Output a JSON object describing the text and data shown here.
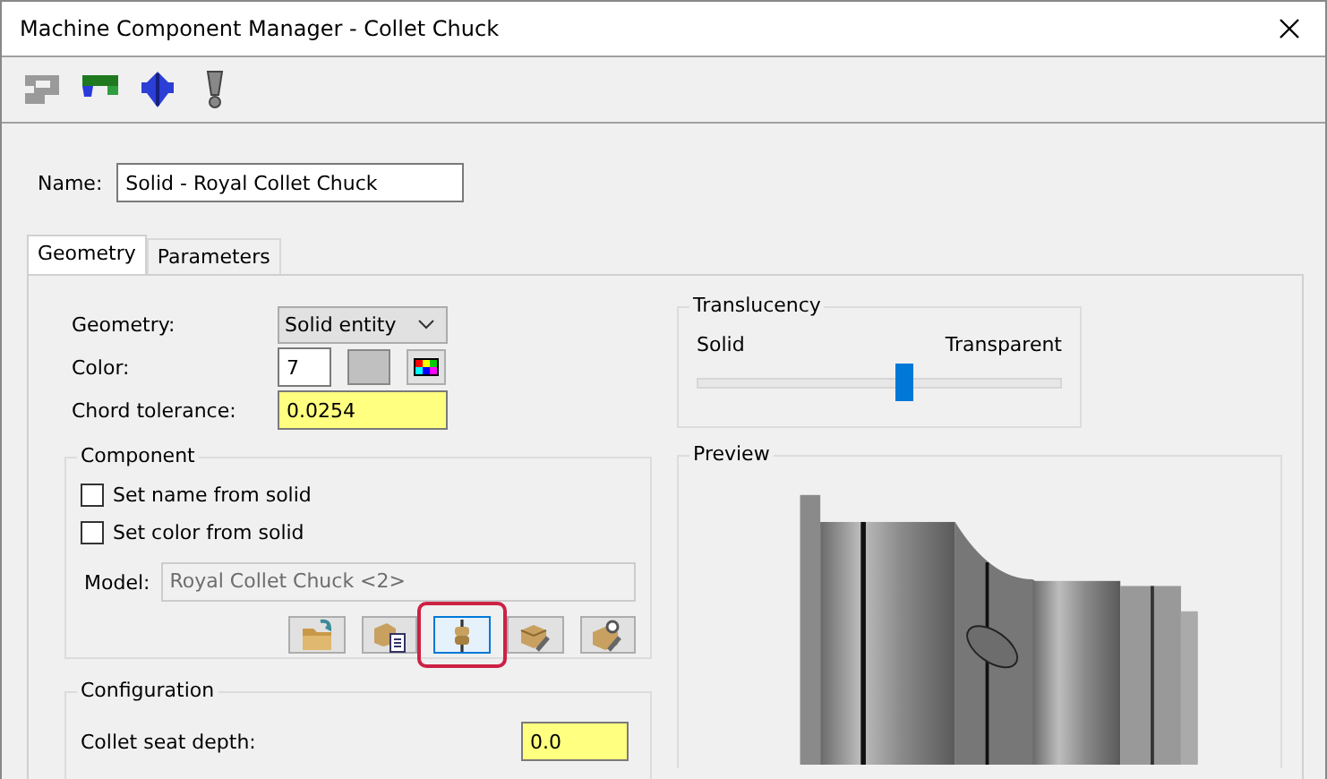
{
  "window": {
    "title": "Machine Component Manager - Collet Chuck"
  },
  "toolbar": [
    {
      "kind": "bracket"
    },
    {
      "kind": "clamp"
    },
    {
      "kind": "diamond"
    },
    {
      "kind": "exclamation"
    }
  ],
  "name": {
    "label": "Name:",
    "value": "Solid - Royal Collet Chuck"
  },
  "tabs": [
    {
      "label": "Geometry",
      "selected": true
    },
    {
      "label": "Parameters",
      "selected": false
    }
  ],
  "geometry": {
    "geometry_label": "Geometry:",
    "geometry_value": "Solid entity",
    "color_label": "Color:",
    "color_value": "7",
    "chord_label": "Chord tolerance:",
    "chord_value": "0.0254"
  },
  "component": {
    "title": "Component",
    "checkboxes": [
      {
        "label": "Set name from solid",
        "checked": false
      },
      {
        "label": "Set color from solid",
        "checked": false
      }
    ],
    "model_label": "Model:",
    "model_value": "Royal Collet Chuck <2>",
    "buttons": [
      {
        "kind": "folder",
        "selected": false,
        "highlighted": false
      },
      {
        "kind": "box-list",
        "selected": false,
        "highlighted": false
      },
      {
        "kind": "chuck",
        "selected": true,
        "highlighted": true
      },
      {
        "kind": "box-wrench",
        "selected": false,
        "highlighted": false
      },
      {
        "kind": "box-magnifier",
        "selected": false,
        "highlighted": false
      }
    ]
  },
  "configuration": {
    "title": "Configuration",
    "fields": [
      {
        "label": "Collet seat depth:",
        "value": "0.0"
      }
    ]
  },
  "translucency": {
    "title": "Translucency",
    "min_label": "Solid",
    "max_label": "Transparent",
    "level": 0.57
  },
  "preview": {
    "title": "Preview",
    "kind": "picture"
  }
}
